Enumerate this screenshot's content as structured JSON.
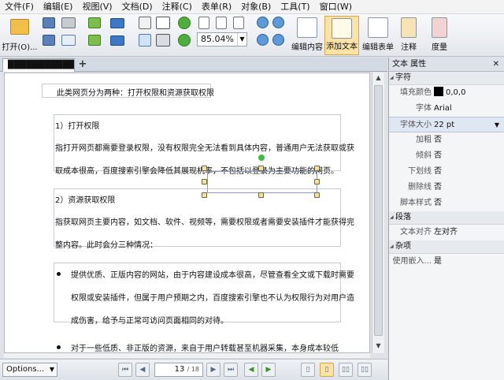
{
  "menu": [
    "文件(F)",
    "编辑(E)",
    "视图(V)",
    "文档(D)",
    "注释(C)",
    "表单(R)",
    "对象(B)",
    "工具(T)",
    "窗口(W)"
  ],
  "toolbar": {
    "open_label": "打开(O)...",
    "zoom_value": "85.04%",
    "edit_content_label": "编辑内容",
    "add_text_label": "添加文本",
    "edit_form_label": "编辑表单",
    "annotate_label": "注释",
    "measure_label": "度量"
  },
  "tab": {
    "label": "████████████"
  },
  "document": {
    "intro": "此类网页分为两种：打开权限和资源获取权限",
    "h1": "1）打开权限",
    "p1a": "指打开网页都需要登录权限，没有权限完全无法看到具体内容，普通用户无法获取或获",
    "p1b": "取成本很高，百度搜索引擎会降低其展现机率，不包括以登录为主要功能的网页。",
    "h2": "2）资源获取权限",
    "p2a": "指获取网页主要内容，如文档、软件、视频等，需要权限或者需要安装插件才能获得完",
    "p2b": "整内容。此时会分三种情况：",
    "b1a": "提供优质、正版内容的网站，由于内容建设成本很高，尽管查看全文或下载时需要",
    "b1b": "权限或安装插件，但属于用户预期之内，百度搜索引擎也不认为权限行为对用户造",
    "b1c": "成伤害，给予与正常可访问页面相同的对待。",
    "b2a": "对于一些低质、非正版的资源，来自于用户转载甚至机器采集，本身成本较低"
  },
  "status": {
    "options_label": "Options...",
    "page_current": "13",
    "page_total": "/ 18"
  },
  "panel": {
    "title": "文本 属性",
    "sections": {
      "font": "字符",
      "paragraph": "段落",
      "misc": "杂项"
    },
    "rows": {
      "fill_color_k": "填充颜色",
      "fill_color_v": "0,0,0",
      "font_k": "字体",
      "font_v": "Arial",
      "size_k": "字体大小",
      "size_v": "22 pt",
      "bold_k": "加粗",
      "bold_v": "否",
      "italic_k": "倾斜",
      "italic_v": "否",
      "underline_k": "下划线",
      "underline_v": "否",
      "strike_k": "删除线",
      "strike_v": "否",
      "script_k": "脚本样式",
      "script_v": "否",
      "align_k": "文本对齐",
      "align_v": "左对齐",
      "embed_k": "使用嵌入...",
      "embed_v": "是"
    }
  },
  "colors": {
    "accent_active": "#fbe3a8",
    "rotate_handle": "#3fbf3f",
    "fill_swatch": "#000000"
  }
}
